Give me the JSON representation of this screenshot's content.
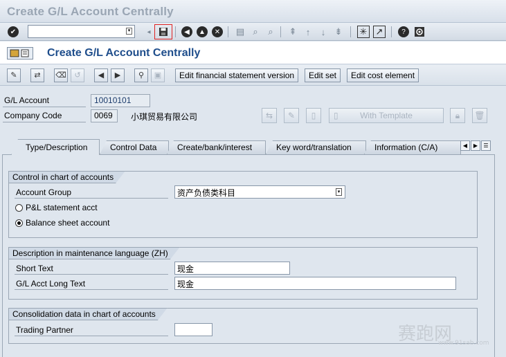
{
  "window": {
    "title": "Create G/L Account Centrally"
  },
  "system_toolbar": {
    "command_field_value": "",
    "icons": [
      "enter-icon",
      "save-icon",
      "back-icon",
      "exit-icon",
      "cancel-icon",
      "print-icon",
      "find-icon",
      "find-next-icon",
      "first-page-icon",
      "prev-page-icon",
      "next-page-icon",
      "last-page-icon",
      "new-session-icon",
      "shortcut-icon",
      "help-icon",
      "customize-icon"
    ]
  },
  "screen": {
    "title": "Create G/L Account Centrally"
  },
  "app_toolbar": {
    "buttons": {
      "fs_version": "Edit financial statement version",
      "edit_set": "Edit set",
      "edit_cost_element": "Edit cost element"
    }
  },
  "header": {
    "gl_account_label": "G/L Account",
    "gl_account_value": "10010101",
    "company_code_label": "Company Code",
    "company_code_value": "0069",
    "company_name": "小琪贸易有限公司",
    "with_template": "With Template"
  },
  "tabs": [
    {
      "label": "Type/Description",
      "active": true
    },
    {
      "label": "Control Data",
      "active": false
    },
    {
      "label": "Create/bank/interest",
      "active": false
    },
    {
      "label": "Key word/translation",
      "active": false
    },
    {
      "label": "Information (C/A)",
      "active": false
    }
  ],
  "groups": {
    "control": {
      "title": "Control in chart of accounts",
      "account_group_label": "Account Group",
      "account_group_value": "资产负债类科目",
      "pl_label": "P&L statement acct",
      "bs_label": "Balance sheet account",
      "selected": "bs"
    },
    "description": {
      "title": "Description in maintenance language (ZH)",
      "short_text_label": "Short Text",
      "short_text_value": "现金",
      "long_text_label": "G/L Acct Long Text",
      "long_text_value": "现金"
    },
    "consolidation": {
      "title": "Consolidation data in chart of accounts",
      "trading_partner_label": "Trading Partner",
      "trading_partner_value": ""
    }
  },
  "watermark": {
    "text": "赛跑网",
    "url": "www.91sab.com"
  }
}
